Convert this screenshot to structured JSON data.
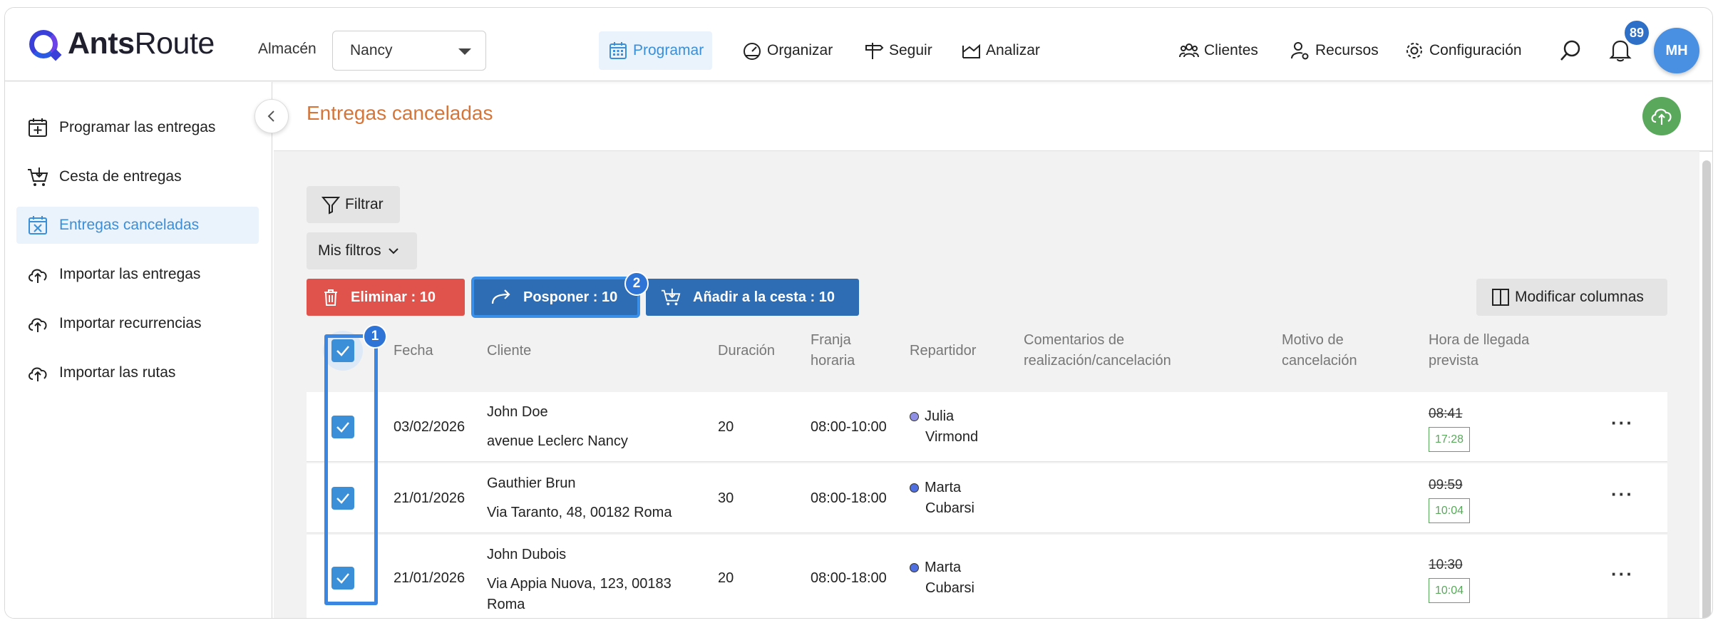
{
  "brand": {
    "logo_bold": "Ants",
    "logo_light": "Route"
  },
  "header": {
    "warehouse_label": "Almacén",
    "warehouse_value": "Nancy",
    "nav": {
      "schedule": "Programar",
      "organize": "Organizar",
      "track": "Seguir",
      "analyze": "Analizar",
      "clients": "Clientes",
      "resources": "Recursos",
      "settings": "Configuración"
    },
    "notifications_count": "89",
    "user_initials": "MH"
  },
  "sidebar": {
    "items": [
      {
        "label": "Programar las entregas",
        "icon": "calendar-plus-icon"
      },
      {
        "label": "Cesta de entregas",
        "icon": "basket-icon"
      },
      {
        "label": "Entregas canceladas",
        "icon": "calendar-x-icon",
        "active": true
      },
      {
        "label": "Importar las entregas",
        "icon": "cloud-upload-icon"
      },
      {
        "label": "Importar recurrencias",
        "icon": "cloud-upload-icon"
      },
      {
        "label": "Importar las rutas",
        "icon": "cloud-upload-icon"
      }
    ]
  },
  "page": {
    "title": "Entregas canceladas",
    "filter_label": "Filtrar",
    "my_filters_label": "Mis filtros",
    "actions": {
      "delete": "Eliminar : 10",
      "postpone": "Posponer : 10",
      "add_basket": "Añadir a la cesta : 10"
    },
    "modify_columns": "Modificar columnas"
  },
  "table": {
    "headers": {
      "date": "Fecha",
      "client": "Cliente",
      "duration": "Duración",
      "slot_1": "Franja",
      "slot_2": "horaria",
      "driver": "Repartidor",
      "comments_1": "Comentarios de",
      "comments_2": "realización/cancelación",
      "reason_1": "Motivo de",
      "reason_2": "cancelación",
      "eta_1": "Hora de llegada",
      "eta_2": "prevista"
    },
    "rows": [
      {
        "date": "03/02/2026",
        "client_name": "John Doe",
        "address_1": "avenue Leclerc Nancy",
        "address_2": "",
        "duration": "20",
        "slot": "08:00-10:00",
        "driver_1": "Julia",
        "driver_2": "Virmond",
        "driver_color": "#8f8fe6",
        "eta_old": "08:41",
        "eta_new": "17:28"
      },
      {
        "date": "21/01/2026",
        "client_name": "Gauthier Brun",
        "address_1": "Via Taranto, 48, 00182 Roma",
        "address_2": "",
        "duration": "30",
        "slot": "08:00-18:00",
        "driver_1": "Marta",
        "driver_2": "Cubarsi",
        "driver_color": "#4f6fe0",
        "eta_old": "09:59",
        "eta_new": "10:04"
      },
      {
        "date": "21/01/2026",
        "client_name": "John Dubois",
        "address_1": "Via Appia Nuova, 123, 00183",
        "address_2": "Roma",
        "duration": "20",
        "slot": "08:00-18:00",
        "driver_1": "Marta",
        "driver_2": "Cubarsi",
        "driver_color": "#4f6fe0",
        "eta_old": "10:30",
        "eta_new": "10:04"
      }
    ]
  },
  "annotations": {
    "badge_1": "1",
    "badge_2": "2"
  },
  "colors": {
    "accent": "#3a8fd8",
    "title": "#d4763b",
    "delete": "#e0534d",
    "primary": "#2e6cb3",
    "success": "#5aa85c"
  }
}
